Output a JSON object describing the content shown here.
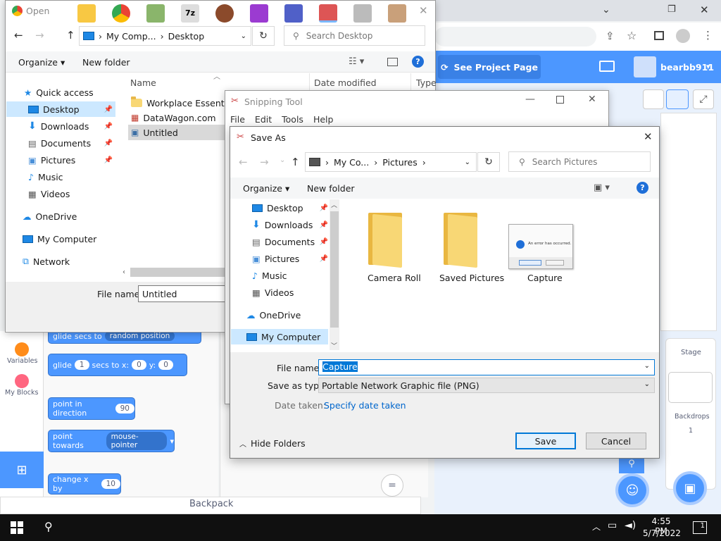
{
  "browser": {
    "see_project": "See Project Page",
    "user": "bearbb911",
    "backpack": "Backpack",
    "stage": "Stage",
    "backdrops": "Backdrops",
    "backdrops_count": "1",
    "variables": "Variables",
    "my_blocks": "My Blocks",
    "blocks": {
      "glide_top": "glide",
      "glide_top_mid": "secs to",
      "glide_top_target": "random position",
      "glide": "glide",
      "glide_secs": "1",
      "secs_to_x": "secs to x:",
      "x_val": "0",
      "y_label": "y:",
      "y_val": "0",
      "point_dir": "point in direction",
      "dir_val": "90",
      "point_towards": "point towards",
      "towards_val": "mouse-pointer",
      "change_x": "change x by",
      "change_val": "10"
    }
  },
  "open_dialog": {
    "title": "Open",
    "path": [
      "My Comp...",
      "Desktop"
    ],
    "search_placeholder": "Search Desktop",
    "organize": "Organize",
    "new_folder": "New folder",
    "col_name": "Name",
    "col_date": "Date modified",
    "col_type": "Type",
    "nav": [
      "Quick access",
      "Desktop",
      "Downloads",
      "Documents",
      "Pictures",
      "Music",
      "Videos",
      "OneDrive",
      "My Computer",
      "Network"
    ],
    "files": [
      "Workplace Essentials",
      "DataWagon.com",
      "Untitled"
    ],
    "file_name_label": "File name:",
    "file_name_value": "Untitled"
  },
  "snipping": {
    "title": "Snipping Tool",
    "menu": [
      "File",
      "Edit",
      "Tools",
      "Help"
    ]
  },
  "save_as": {
    "title": "Save As",
    "path": [
      "My Co...",
      "Pictures"
    ],
    "search_placeholder": "Search Pictures",
    "organize": "Organize",
    "new_folder": "New folder",
    "nav": [
      "Desktop",
      "Downloads",
      "Documents",
      "Pictures",
      "Music",
      "Videos",
      "OneDrive",
      "My Computer"
    ],
    "items": [
      "Camera Roll",
      "Saved Pictures",
      "Capture"
    ],
    "thumb_text": "An error has occurred.",
    "file_name_label": "File name:",
    "file_name_value": "Capture",
    "type_label": "Save as type:",
    "type_value": "Portable Network Graphic file (PNG)",
    "date_label": "Date taken:",
    "date_link": "Specify date taken",
    "hide_folders": "Hide Folders",
    "save": "Save",
    "cancel": "Cancel"
  },
  "taskbar": {
    "time": "4:55 PM",
    "date": "5/7/2022",
    "notif": "1"
  }
}
